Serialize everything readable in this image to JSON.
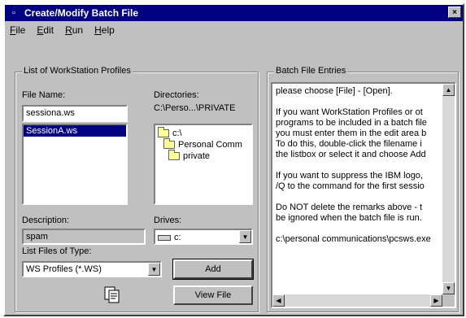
{
  "window": {
    "title": "Create/Modify Batch File",
    "close_glyph": "×",
    "sys_glyph": "▫"
  },
  "menu": [
    {
      "label": "File"
    },
    {
      "label": "Edit"
    },
    {
      "label": "Run"
    },
    {
      "label": "Help"
    }
  ],
  "profiles_group": {
    "title": "List of WorkStation Profiles",
    "file_name_label": "File Name:",
    "file_name_value": "sessiona.ws",
    "file_list": [
      "SessionA.ws"
    ],
    "selected_index": 0,
    "directories_label": "Directories:",
    "directories_path": "C:\\Perso...\\PRIVATE",
    "dir_tree": [
      "c:\\",
      "Personal Comm",
      "private"
    ],
    "description_label": "Description:",
    "description_value": "spam",
    "drives_label": "Drives:",
    "drive_value": "c:",
    "file_type_label": "List Files of Type:",
    "file_type_value": "WS Profiles (*.WS)",
    "add_button": "Add",
    "view_button": "View File"
  },
  "batch_group": {
    "title": "Batch File Entries",
    "lines": [
      "please choose [File] - [Open].",
      "",
      "If you want WorkStation Profiles or ot",
      "programs to be included in a batch file",
      "you must enter them in the edit area b",
      "To do this, double-click the filename i",
      "the listbox or select it and choose Add",
      "",
      "If you want to suppress the IBM logo,",
      "/Q to the command for the first sessio",
      "",
      "Do NOT delete the remarks above - t",
      "be ignored when the batch file is run.",
      "",
      "c:\\personal communications\\pcsws.exe"
    ]
  },
  "icons": {
    "scroll_up": "▲",
    "scroll_down": "▼",
    "scroll_left": "◀",
    "scroll_right": "▶",
    "dropdown": "▼"
  }
}
